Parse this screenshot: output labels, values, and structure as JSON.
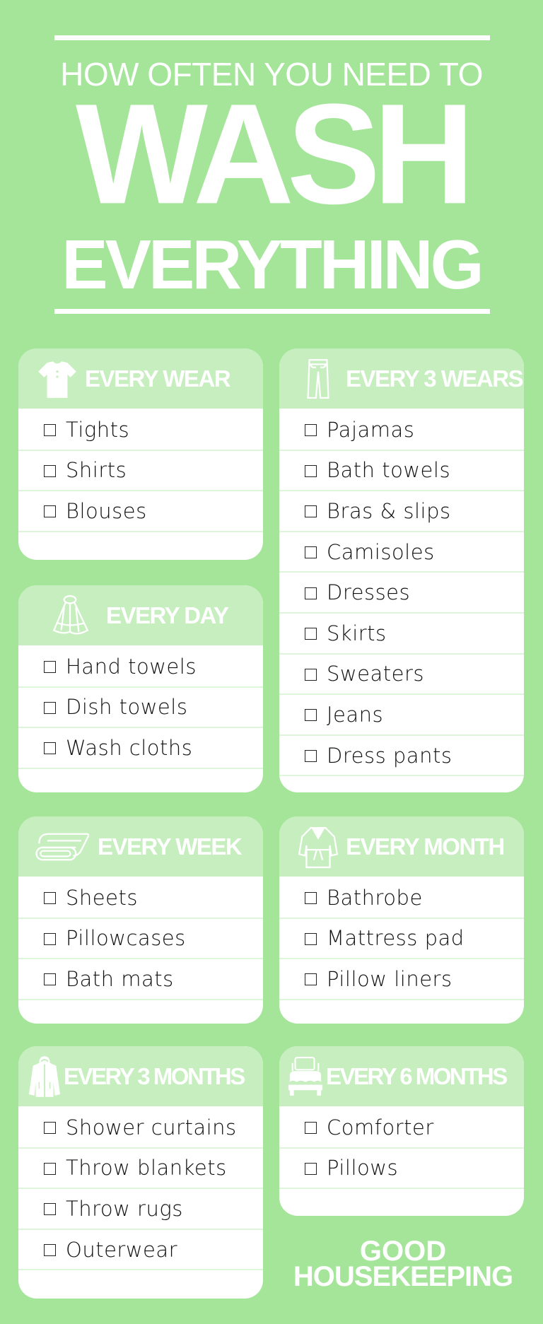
{
  "header": {
    "subtitle": "HOW OFTEN YOU NEED TO",
    "title_main": "WASH",
    "title_sub": "EVERYTHING"
  },
  "colors": {
    "background": "#a4e59a",
    "card_header": "#c6eebf",
    "card_body": "#ffffff",
    "row_divider": "#dff5db",
    "text": "#111111",
    "header_text": "#ffffff"
  },
  "cards": [
    {
      "title": "EVERY WEAR",
      "icon": "t-shirt-icon",
      "items": [
        "Tights",
        "Shirts",
        "Blouses"
      ]
    },
    {
      "title": "EVERY 3 WEARS",
      "icon": "pants-icon",
      "items": [
        "Pajamas",
        "Bath towels",
        "Bras & slips",
        "Camisoles",
        "Dresses",
        "Skirts",
        "Sweaters",
        "Jeans",
        "Dress pants"
      ]
    },
    {
      "title": "EVERY DAY",
      "icon": "hand-towel-icon",
      "items": [
        "Hand towels",
        "Dish towels",
        "Wash cloths"
      ]
    },
    {
      "title": "EVERY WEEK",
      "icon": "folded-sheets-icon",
      "items": [
        "Sheets",
        "Pillowcases",
        "Bath mats"
      ]
    },
    {
      "title": "EVERY MONTH",
      "icon": "bathrobe-icon",
      "items": [
        "Bathrobe",
        "Mattress pad",
        "Pillow liners"
      ]
    },
    {
      "title": "EVERY 3 MONTHS",
      "icon": "jacket-icon",
      "items": [
        "Shower curtains",
        "Throw blankets",
        "Throw rugs",
        "Outerwear"
      ]
    },
    {
      "title": "EVERY 6 MONTHS",
      "icon": "bed-icon",
      "items": [
        "Comforter",
        "Pillows"
      ]
    }
  ],
  "logo": {
    "line1": "GOOD",
    "line2": "HOUSEKEEPING"
  }
}
